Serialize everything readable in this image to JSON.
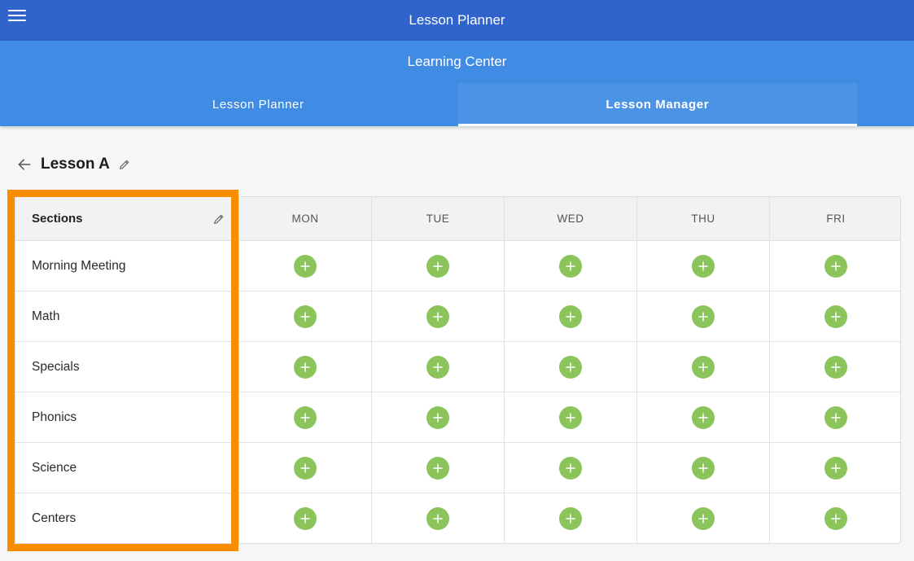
{
  "app": {
    "title": "Lesson Planner"
  },
  "center": {
    "title": "Learning Center"
  },
  "tabs": [
    {
      "label": "Lesson Planner",
      "active": false
    },
    {
      "label": "Lesson Manager",
      "active": true
    }
  ],
  "lesson": {
    "title": "Lesson A"
  },
  "grid": {
    "sections_header": "Sections",
    "days": [
      "MON",
      "TUE",
      "WED",
      "THU",
      "FRI"
    ],
    "sections": [
      "Morning Meeting",
      "Math",
      "Specials",
      "Phonics",
      "Science",
      "Centers"
    ]
  },
  "icons": {
    "menu": "menu-icon",
    "back": "arrow-left-icon",
    "edit": "pencil-icon",
    "add": "plus-icon"
  },
  "colors": {
    "appbar": "#2f64cc",
    "subheader": "#408be3",
    "add_button": "#8bc45a",
    "highlight": "#fb8c00"
  }
}
